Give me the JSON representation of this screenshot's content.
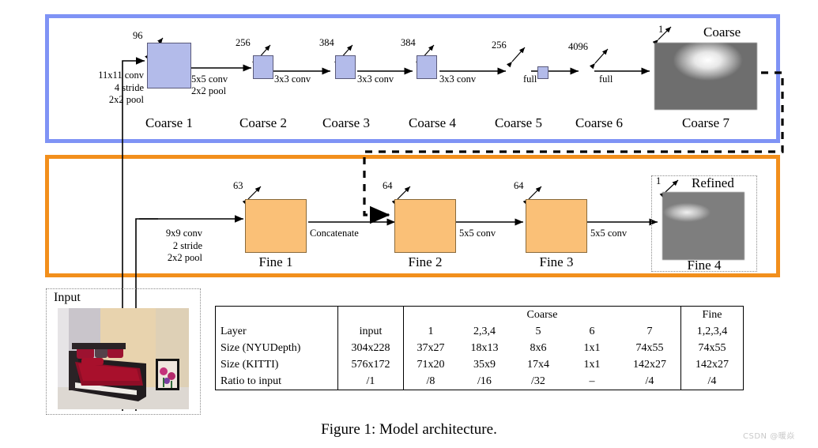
{
  "figure": {
    "caption": "Figure 1: Model architecture.",
    "watermark": "CSDN @暖焱"
  },
  "colors": {
    "coarse_panel_border": "#7f93f5",
    "fine_panel_border": "#f28f1c",
    "coarse_block_fill": "#b3bbea",
    "fine_block_fill": "#fac077"
  },
  "input": {
    "title": "Input",
    "photo_alt": "bedroom-photo"
  },
  "coarse": {
    "input_op": "11x11 conv\n4 stride\n2x2 pool",
    "output_title": "Coarse",
    "output_channels": "1",
    "stages": [
      {
        "name": "Coarse 1",
        "channels": "96",
        "next_op": "5x5 conv\n2x2 pool"
      },
      {
        "name": "Coarse 2",
        "channels": "256",
        "next_op": "3x3 conv"
      },
      {
        "name": "Coarse 3",
        "channels": "384",
        "next_op": "3x3 conv"
      },
      {
        "name": "Coarse 4",
        "channels": "384",
        "next_op": "3x3 conv"
      },
      {
        "name": "Coarse 5",
        "channels": "256",
        "next_op": "full"
      },
      {
        "name": "Coarse 6",
        "channels": "4096",
        "next_op": "full"
      },
      {
        "name": "Coarse 7",
        "channels": "1",
        "next_op": ""
      }
    ]
  },
  "fine": {
    "input_op": "9x9 conv\n2 stride\n2x2 pool",
    "output_title": "Refined",
    "output_channels": "1",
    "concat_label": "Concatenate",
    "stages": [
      {
        "name": "Fine 1",
        "channels": "63",
        "next_op": "Concatenate"
      },
      {
        "name": "Fine 2",
        "channels": "64",
        "next_op": "5x5 conv"
      },
      {
        "name": "Fine 3",
        "channels": "64",
        "next_op": "5x5 conv"
      },
      {
        "name": "Fine 4",
        "channels": "1",
        "next_op": ""
      }
    ]
  },
  "table": {
    "group_headers": [
      "",
      "",
      "Coarse",
      "Fine"
    ],
    "columns": [
      "Layer",
      "input",
      "1",
      "2,3,4",
      "5",
      "6",
      "7",
      "1,2,3,4"
    ],
    "rows": [
      {
        "label": "Size (NYUDepth)",
        "values": [
          "304x228",
          "37x27",
          "18x13",
          "8x6",
          "1x1",
          "74x55",
          "74x55"
        ]
      },
      {
        "label": "Size (KITTI)",
        "values": [
          "576x172",
          "71x20",
          "35x9",
          "17x4",
          "1x1",
          "142x27",
          "142x27"
        ]
      },
      {
        "label": "Ratio to input",
        "values": [
          "/1",
          "/8",
          "/16",
          "/32",
          "–",
          "/4",
          "/4"
        ]
      }
    ]
  }
}
